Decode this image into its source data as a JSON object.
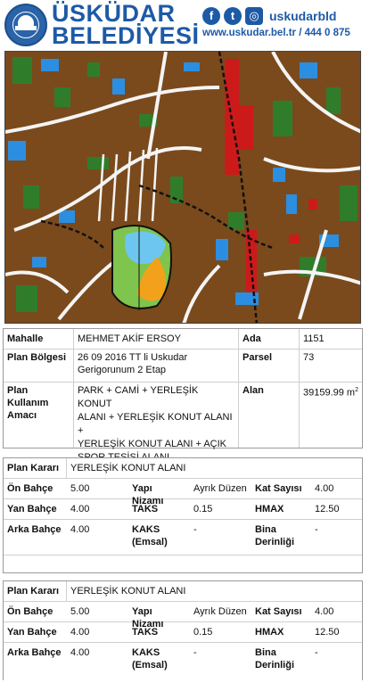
{
  "header": {
    "brand_line1": "ÜSKÜDAR",
    "brand_line2": "BELEDİYESİ",
    "social_handle": "uskudarbld",
    "website": "www.uskudar.bel.tr / 444 0 875",
    "facebook_glyph": "f",
    "twitter_glyph": "t",
    "instagram_glyph": "◎",
    "brand_color": "#1d5aa6"
  },
  "parcel": {
    "mahalle_label": "Mahalle",
    "mahalle_value": "MEHMET AKİF ERSOY",
    "ada_label": "Ada",
    "ada_value": "1151",
    "plan_bolgesi_label": "Plan Bölgesi",
    "plan_bolgesi_value_line1": "26 09 2016 TT li Uskudar",
    "plan_bolgesi_value_line2": "Gerigorunum 2 Etap",
    "parsel_label": "Parsel",
    "parsel_value": "73",
    "plan_kullanim_label_line1": "Plan Kullanım",
    "plan_kullanim_label_line2": "Amacı",
    "plan_kullanim_lines": [
      "PARK + CAMİ + YERLEŞİK KONUT",
      "ALANI + YERLEŞİK KONUT ALANI +",
      "YERLEŞİK KONUT ALANI + AÇIK",
      "SPOR TESİSİ ALANI"
    ],
    "alan_label": "Alan",
    "alan_value": "39159.99 m",
    "alan_unit_sup": "2"
  },
  "plans": [
    {
      "plan_karari_label": "Plan Kararı",
      "plan_karari_value": "YERLEŞİK KONUT ALANI",
      "on_bahce_label": "Ön Bahçe",
      "on_bahce_value": "5.00",
      "yapi_nizami_label": "Yapı Nizamı",
      "yapi_nizami_value": "Ayrık Düzen",
      "kat_sayisi_label": "Kat Sayısı",
      "kat_sayisi_value": "4.00",
      "yan_bahce_label": "Yan Bahçe",
      "yan_bahce_value": "4.00",
      "taks_label": "TAKS",
      "taks_value": "0.15",
      "hmax_label": "HMAX",
      "hmax_value": "12.50",
      "arka_bahce_label": "Arka Bahçe",
      "arka_bahce_value": "4.00",
      "kaks_label_line1": "KAKS",
      "kaks_label_line2": "(Emsal)",
      "kaks_value": "-",
      "bina_derinligi_label_line1": "Bina",
      "bina_derinligi_label_line2": "Derinliği",
      "bina_derinligi_value": "-"
    },
    {
      "plan_karari_label": "Plan Kararı",
      "plan_karari_value": "YERLEŞİK KONUT ALANI",
      "on_bahce_label": "Ön Bahçe",
      "on_bahce_value": "5.00",
      "yapi_nizami_label": "Yapı Nizamı",
      "yapi_nizami_value": "Ayrık Düzen",
      "kat_sayisi_label": "Kat Sayısı",
      "kat_sayisi_value": "4.00",
      "yan_bahce_label": "Yan Bahçe",
      "yan_bahce_value": "4.00",
      "taks_label": "TAKS",
      "taks_value": "0.15",
      "hmax_label": "HMAX",
      "hmax_value": "12.50",
      "arka_bahce_label": "Arka Bahçe",
      "arka_bahce_value": "4.00",
      "kaks_label_line1": "KAKS",
      "kaks_label_line2": "(Emsal)",
      "kaks_value": "-",
      "bina_derinligi_label_line1": "Bina",
      "bina_derinligi_label_line2": "Derinliği",
      "bina_derinligi_value": "-"
    }
  ]
}
